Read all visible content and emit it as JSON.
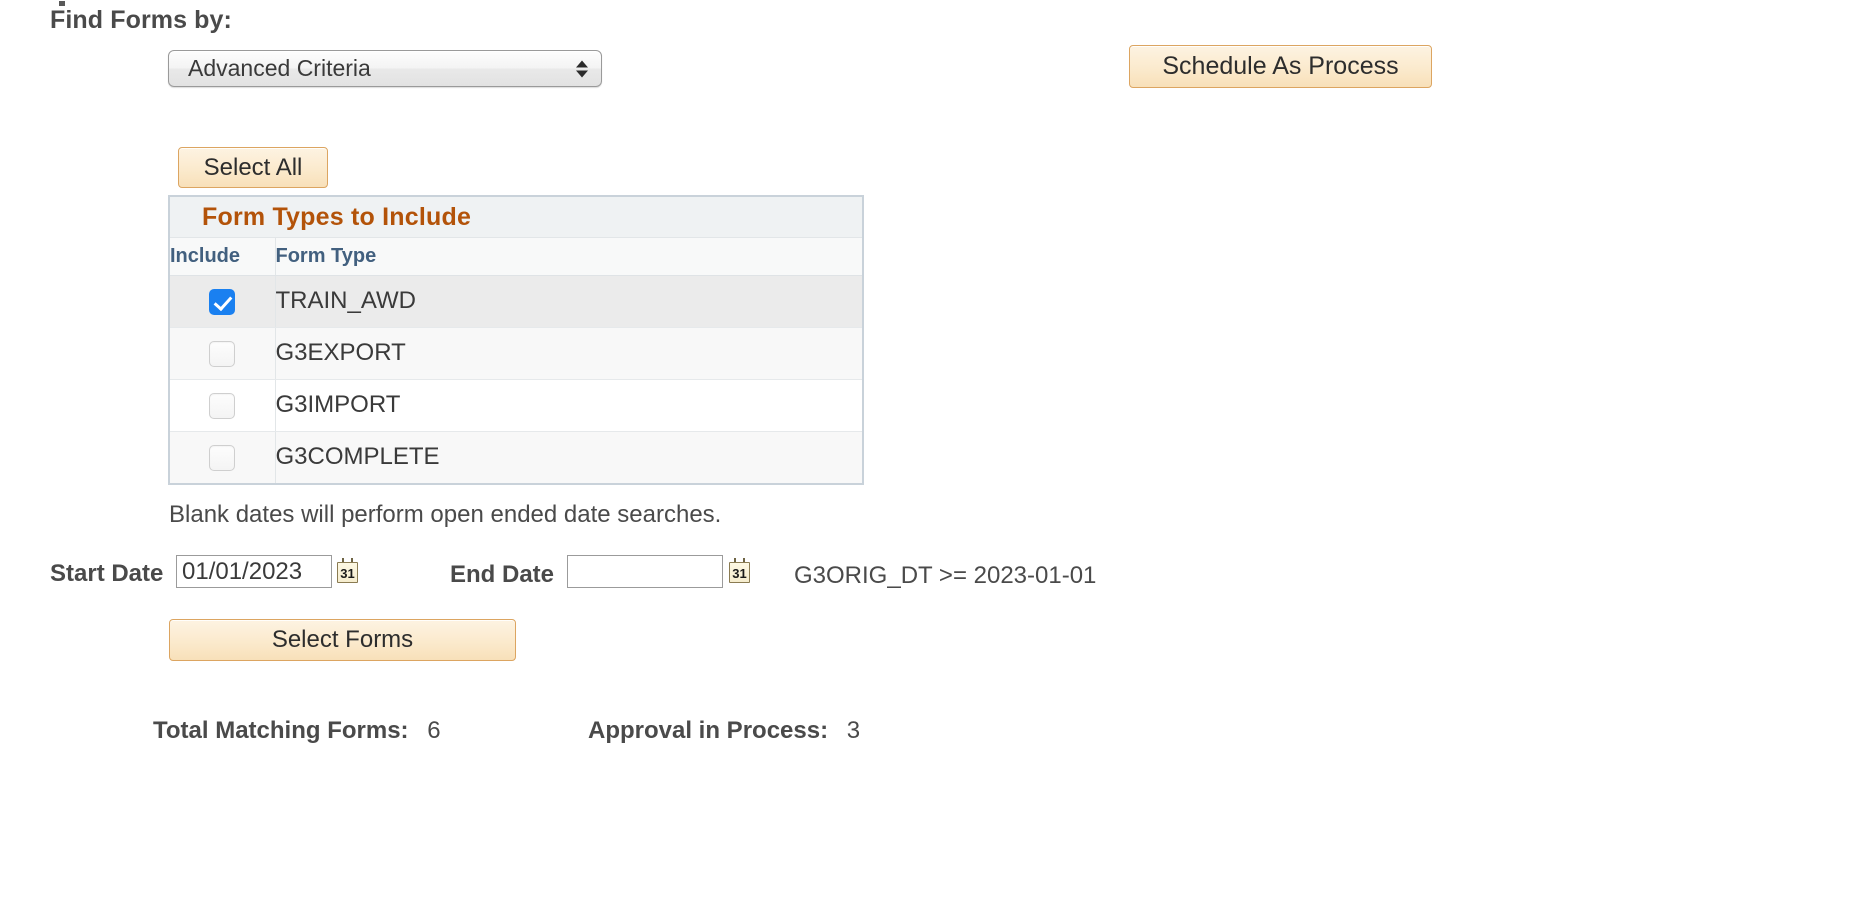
{
  "find_forms": {
    "label": "Find Forms by:",
    "criteria_value": "Advanced Criteria"
  },
  "toolbar": {
    "schedule_as_process_label": "Schedule As Process",
    "select_all_label": "Select All",
    "select_forms_label": "Select Forms"
  },
  "grid": {
    "title": "Form Types to Include",
    "columns": [
      "Include",
      "Form Type"
    ],
    "rows": [
      {
        "form_type": "TRAIN_AWD",
        "included": true
      },
      {
        "form_type": "G3EXPORT",
        "included": false
      },
      {
        "form_type": "G3IMPORT",
        "included": false
      },
      {
        "form_type": "G3COMPLETE",
        "included": false
      }
    ]
  },
  "dates": {
    "note": "Blank dates will perform open ended date searches.",
    "start_label": "Start Date",
    "start_value": "01/01/2023",
    "end_label": "End Date",
    "end_value": "",
    "expression": "G3ORIG_DT >= 2023-01-01",
    "calendar_icon_day": "31"
  },
  "totals": {
    "matching_label": "Total Matching Forms:",
    "matching_value": "6",
    "approval_label": "Approval in Process:",
    "approval_value": "3"
  },
  "colors": {
    "grid_title_text": "#b35309",
    "column_header_text": "#42607f",
    "button_border": "#dca561",
    "checkbox_checked": "#1a80f0",
    "grid_border": "#c9d2da"
  }
}
